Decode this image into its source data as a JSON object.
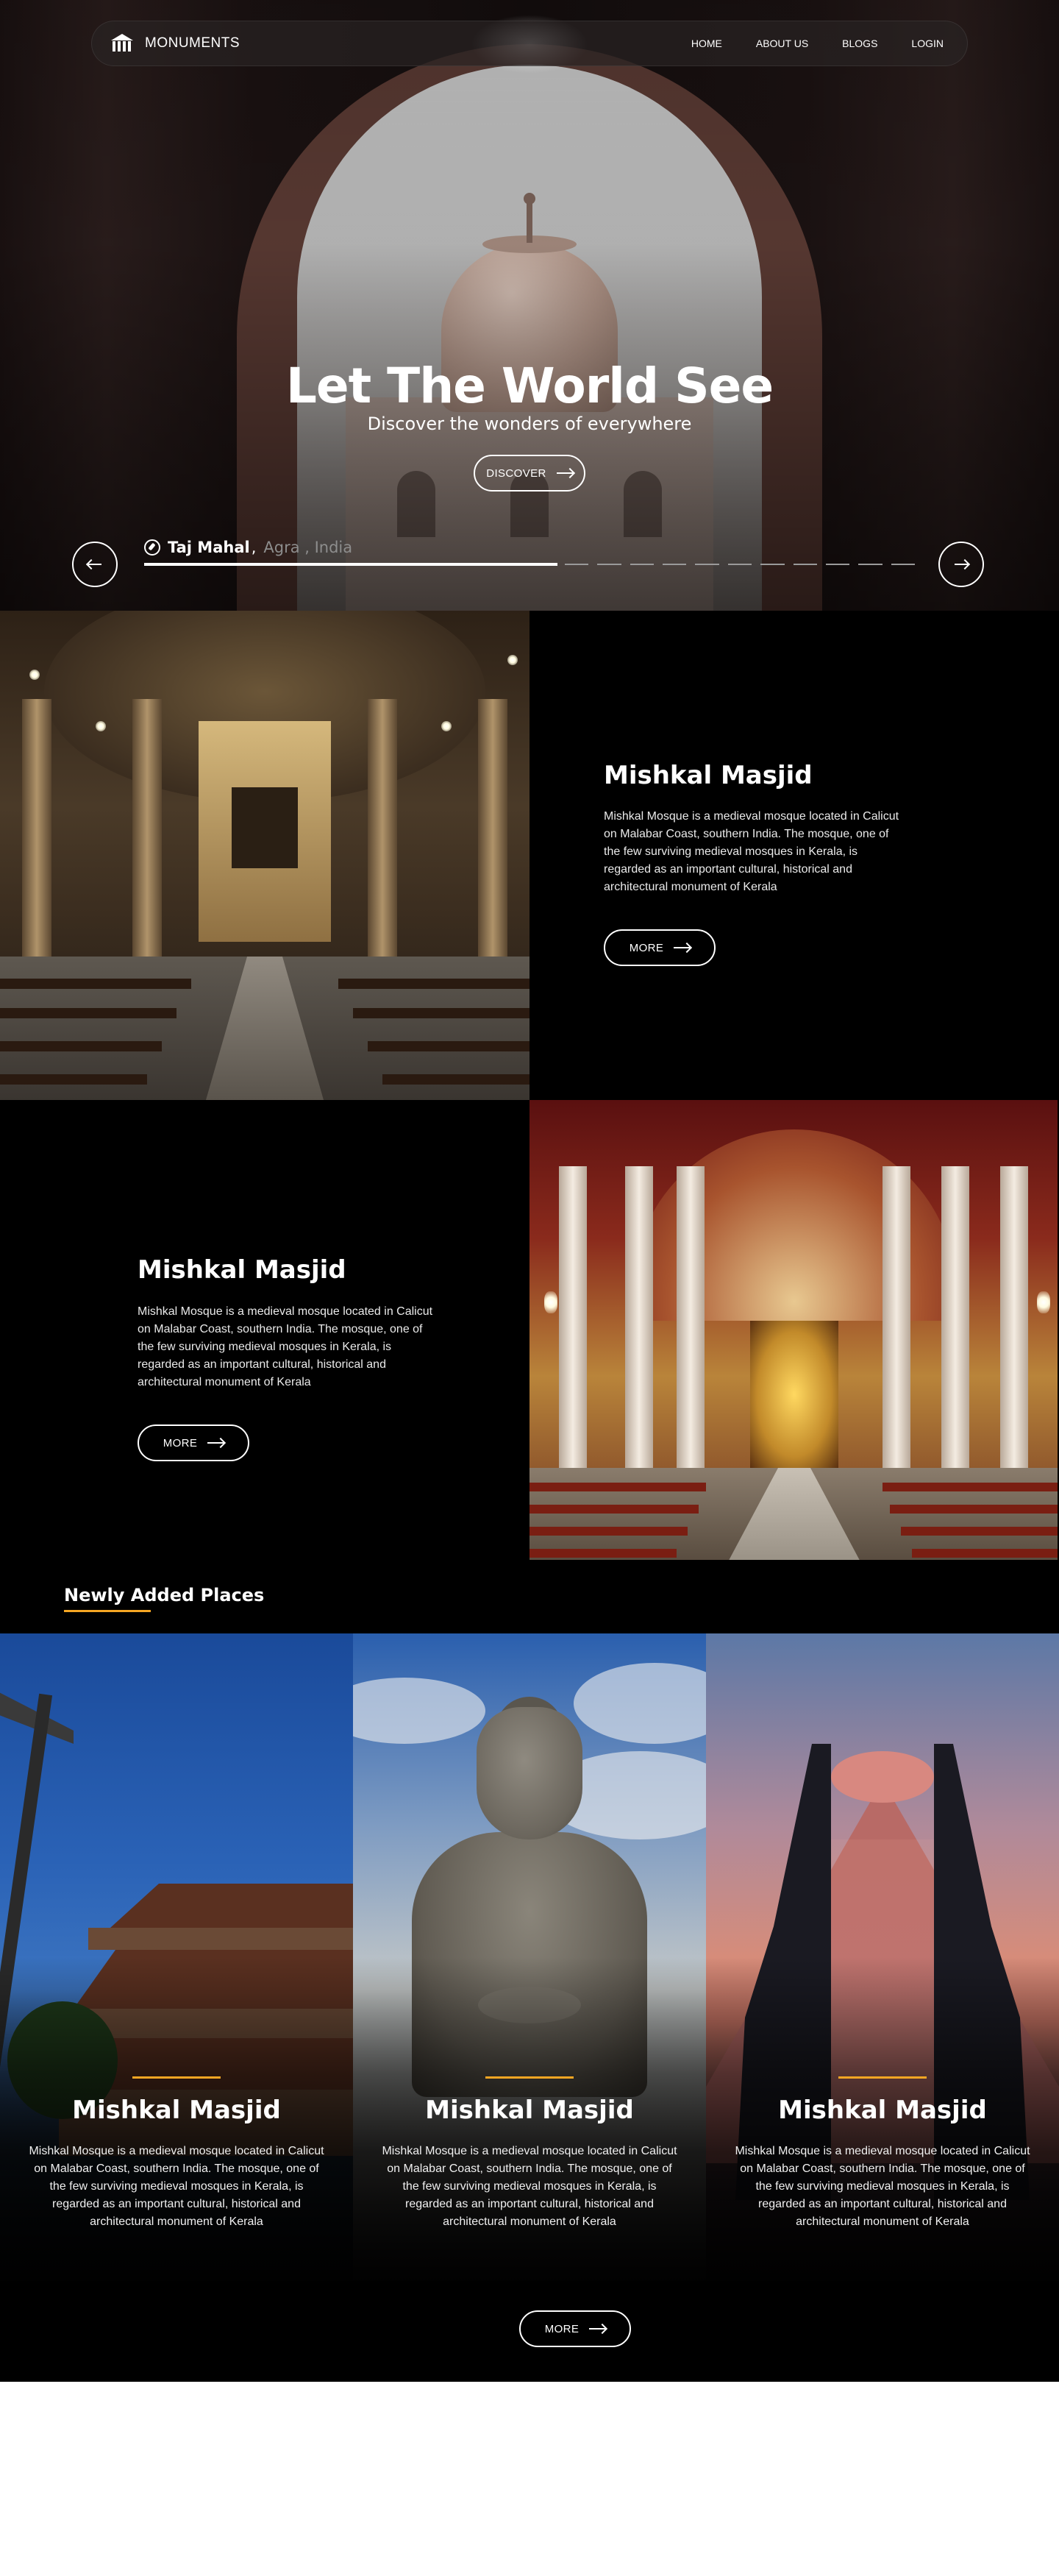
{
  "nav": {
    "brand": "MONUMENTS",
    "links": [
      "HOME",
      "ABOUT US",
      "BLOGS",
      "LOGIN"
    ]
  },
  "hero": {
    "title": "Let The World See",
    "subtitle": "Discover the wonders of everywhere",
    "cta": "DISCOVER",
    "location": {
      "name": "Taj Mahal",
      "separator": ",",
      "city": "Agra , India"
    },
    "slider_progress": 0.53,
    "slider_segments": 11
  },
  "features": [
    {
      "title": "Mishkal Masjid",
      "description": "Mishkal Mosque is a medieval mosque located in Calicut on Malabar Coast, southern India. The mosque, one of the few surviving medieval mosques in Kerala, is regarded as an important cultural, historical and architectural monument of Kerala",
      "button": "MORE"
    },
    {
      "title": "Mishkal Masjid",
      "description": "Mishkal Mosque is a medieval mosque located in Calicut on Malabar Coast, southern India. The mosque, one of the few surviving medieval mosques in Kerala, is regarded as an important cultural, historical and architectural monument of Kerala",
      "button": "MORE"
    }
  ],
  "newly_added": {
    "heading": "Newly Added Places",
    "accent": "#f5a623",
    "places": [
      {
        "title": "Mishkal Masjid",
        "description": "Mishkal Mosque is a medieval mosque located in Calicut on Malabar Coast, southern India. The mosque, one of the few surviving medieval mosques in Kerala, is regarded as an important cultural, historical and architectural monument of Kerala"
      },
      {
        "title": "Mishkal Masjid",
        "description": "Mishkal Mosque is a medieval mosque located in Calicut on Malabar Coast, southern India. The mosque, one of the few surviving medieval mosques in Kerala, is regarded as an important cultural, historical and architectural monument of Kerala"
      },
      {
        "title": "Mishkal Masjid",
        "description": "Mishkal Mosque is a medieval mosque located in Calicut on Malabar Coast, southern India. The mosque, one of the few surviving medieval mosques in Kerala, is regarded as an important cultural, historical and architectural monument of Kerala"
      }
    ],
    "button": "MORE"
  },
  "icons": {
    "logo": "monument-logo-icon",
    "location": "compass-icon",
    "prev": "arrow-left-icon",
    "next": "arrow-right-icon",
    "button_arrow": "arrow-right-icon"
  }
}
